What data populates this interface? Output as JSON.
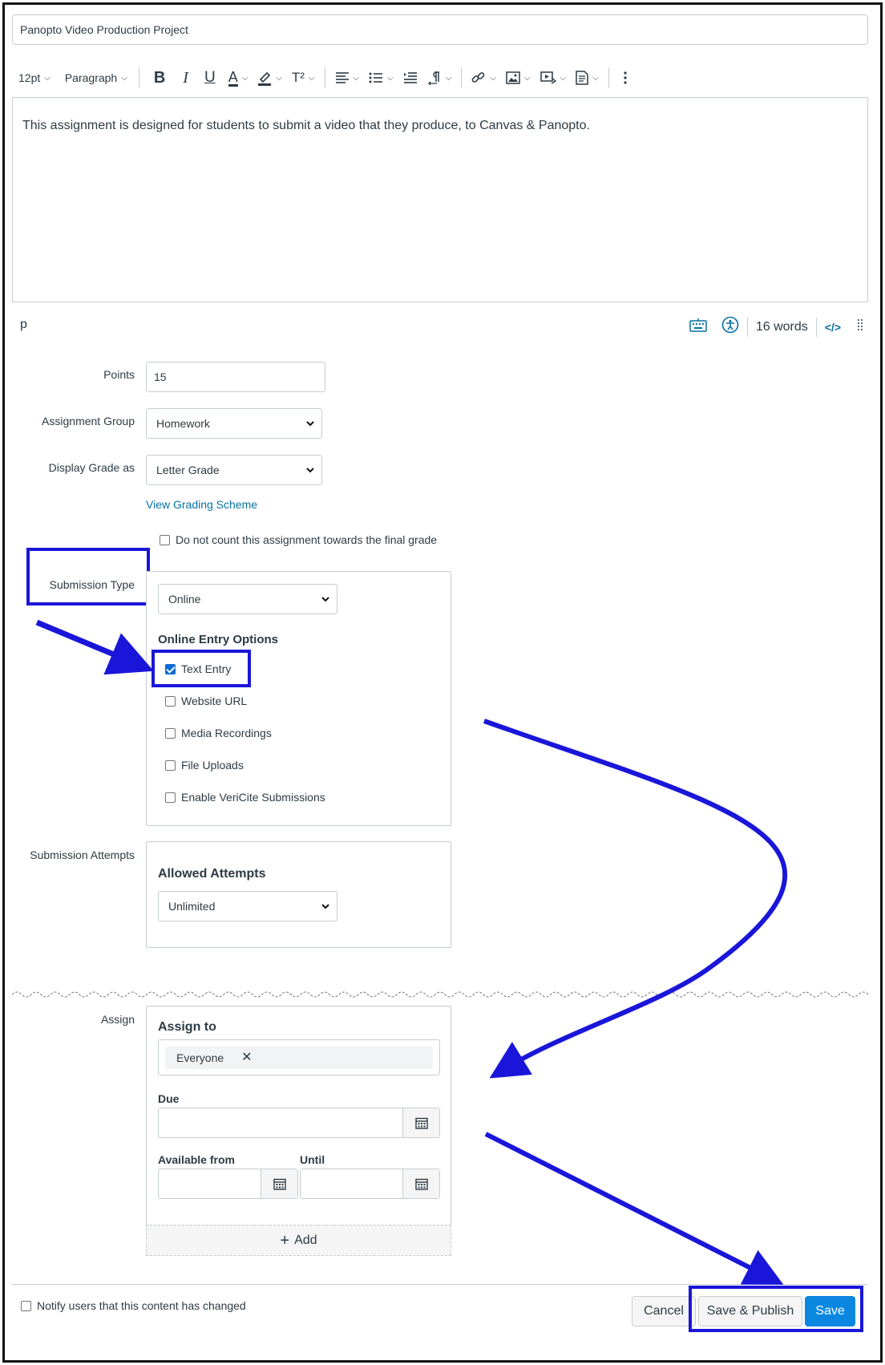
{
  "title_input": {
    "value": "Panopto Video Production Project"
  },
  "toolbar": {
    "font_size": "12pt",
    "block_format": "Paragraph",
    "bold": "B",
    "italic": "I",
    "underline": "U",
    "superscript": "T²"
  },
  "editor": {
    "body": "This assignment is designed for students to submit a video that they produce, to Canvas & Panopto."
  },
  "status_bar": {
    "element_path": "p",
    "word_count": "16 words",
    "html_toggle": "</>"
  },
  "form": {
    "points": {
      "label": "Points",
      "value": "15"
    },
    "assignment_group": {
      "label": "Assignment Group",
      "value": "Homework"
    },
    "display_grade": {
      "label": "Display Grade as",
      "value": "Letter Grade"
    },
    "grading_scheme_link": "View Grading Scheme",
    "do_not_count": {
      "label": "Do not count this assignment towards the final grade",
      "checked": false
    },
    "submission_type": {
      "label": "Submission Type",
      "value": "Online",
      "online_entry_title": "Online Entry Options",
      "options": [
        {
          "label": "Text Entry",
          "checked": true
        },
        {
          "label": "Website URL",
          "checked": false
        },
        {
          "label": "Media Recordings",
          "checked": false
        },
        {
          "label": "File Uploads",
          "checked": false
        },
        {
          "label": "Enable VeriCite Submissions",
          "checked": false
        }
      ]
    },
    "submission_attempts": {
      "label": "Submission Attempts",
      "title": "Allowed Attempts",
      "value": "Unlimited"
    },
    "assign": {
      "label": "Assign",
      "assign_to_title": "Assign to",
      "assignee_chip": "Everyone",
      "due_label": "Due",
      "available_from_label": "Available from",
      "until_label": "Until",
      "add_label": "Add"
    }
  },
  "footer": {
    "notify_label": "Notify users that this content has changed",
    "cancel_label": "Cancel",
    "save_publish_label": "Save & Publish",
    "save_label": "Save"
  },
  "colors": {
    "annotation": "#1a16d9",
    "link": "#0770a3",
    "primary_button": "#0b87e0",
    "checkbox_checked": "#0b6bd6"
  }
}
